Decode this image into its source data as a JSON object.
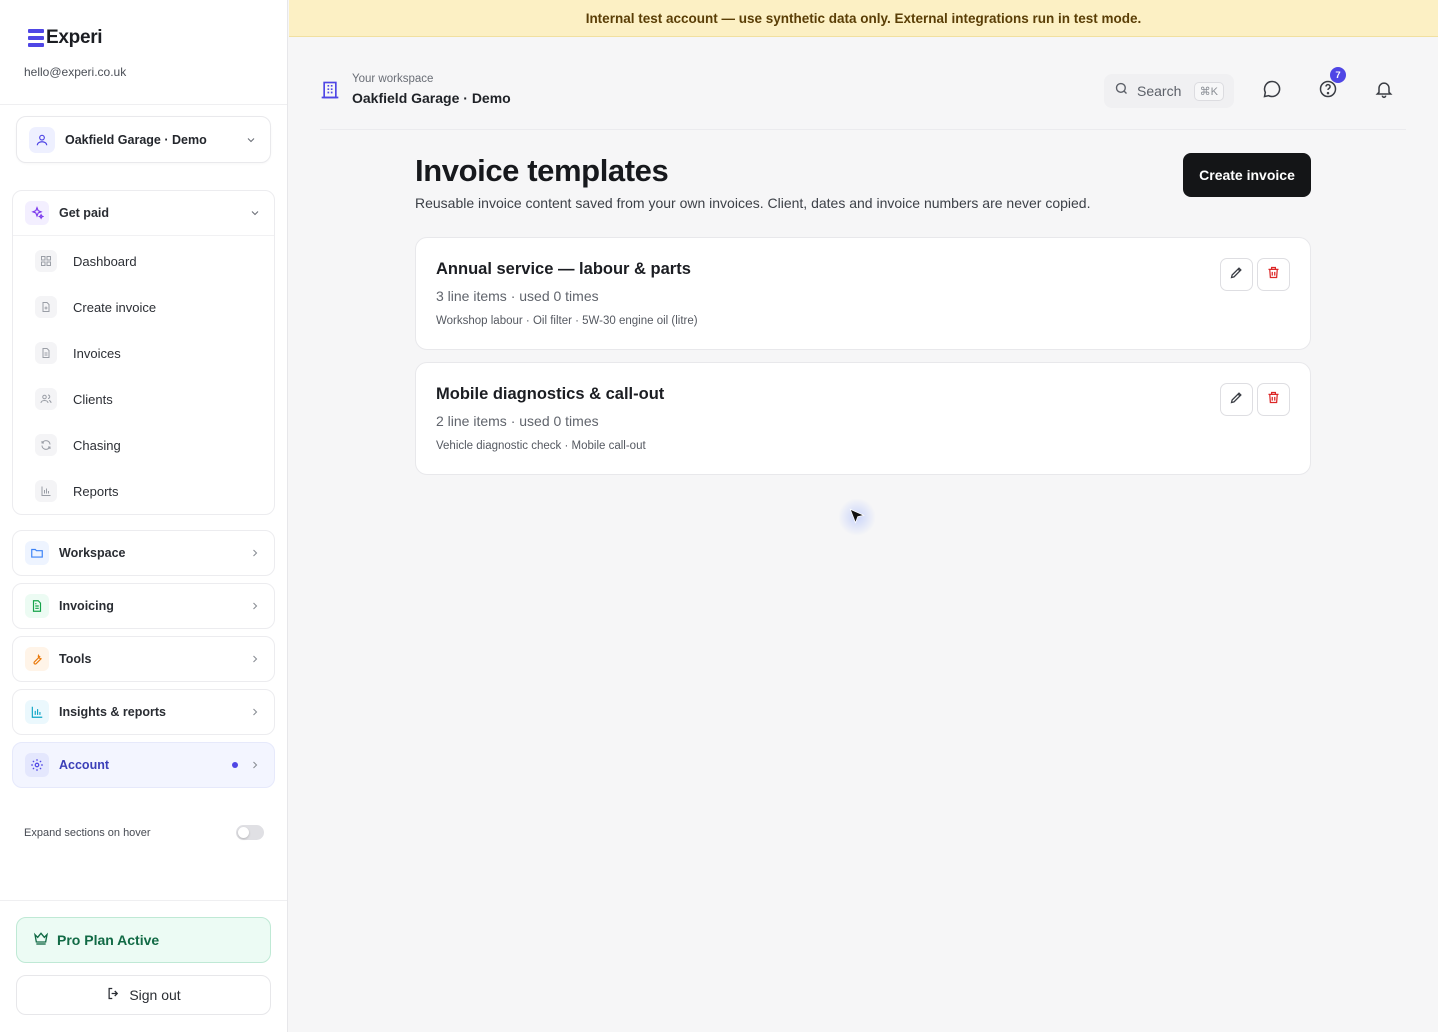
{
  "brand": {
    "name": "Experi",
    "color": "#4f46e5"
  },
  "user": {
    "email": "hello@experi.co.uk"
  },
  "workspace_select": {
    "name": "Oakfield Garage · Demo"
  },
  "nav": {
    "get_paid": {
      "label": "Get paid",
      "items": [
        {
          "label": "Dashboard",
          "icon": "dashboard-icon"
        },
        {
          "label": "Create invoice",
          "icon": "file-plus-icon"
        },
        {
          "label": "Invoices",
          "icon": "document-icon"
        },
        {
          "label": "Clients",
          "icon": "users-icon"
        },
        {
          "label": "Chasing",
          "icon": "refresh-icon"
        },
        {
          "label": "Reports",
          "icon": "bar-chart-icon"
        }
      ]
    },
    "workspace": {
      "label": "Workspace"
    },
    "invoicing": {
      "label": "Invoicing"
    },
    "tools": {
      "label": "Tools"
    },
    "insights": {
      "label": "Insights & reports"
    },
    "account": {
      "label": "Account"
    }
  },
  "settings": {
    "expand_on_hover_label": "Expand sections on hover",
    "expand_on_hover": false
  },
  "plan": {
    "label": "Pro Plan Active"
  },
  "signout": {
    "label": "Sign out"
  },
  "banner": {
    "text": "Internal test account — use synthetic data only. External integrations run in test mode."
  },
  "header": {
    "workspace_label": "Your workspace",
    "workspace_name": "Oakfield Garage · Demo",
    "search_placeholder": "Search",
    "search_shortcut": "⌘K",
    "help_badge": "7"
  },
  "page": {
    "title": "Invoice templates",
    "subtitle": "Reusable invoice content saved from your own invoices. Client, dates and invoice numbers are never copied.",
    "create_button": "Create invoice"
  },
  "templates": [
    {
      "name": "Annual service — labour & parts",
      "meta": "3 line items · used 0 times",
      "items": "Workshop labour · Oil filter · 5W-30 engine oil (litre)"
    },
    {
      "name": "Mobile diagnostics & call-out",
      "meta": "2 line items · used 0 times",
      "items": "Vehicle diagnostic check · Mobile call-out"
    }
  ],
  "colors": {
    "accent": "#4f46e5",
    "delete": "#dc2626",
    "banner_bg": "#fcf0c4",
    "plan_green": "#116a45"
  }
}
